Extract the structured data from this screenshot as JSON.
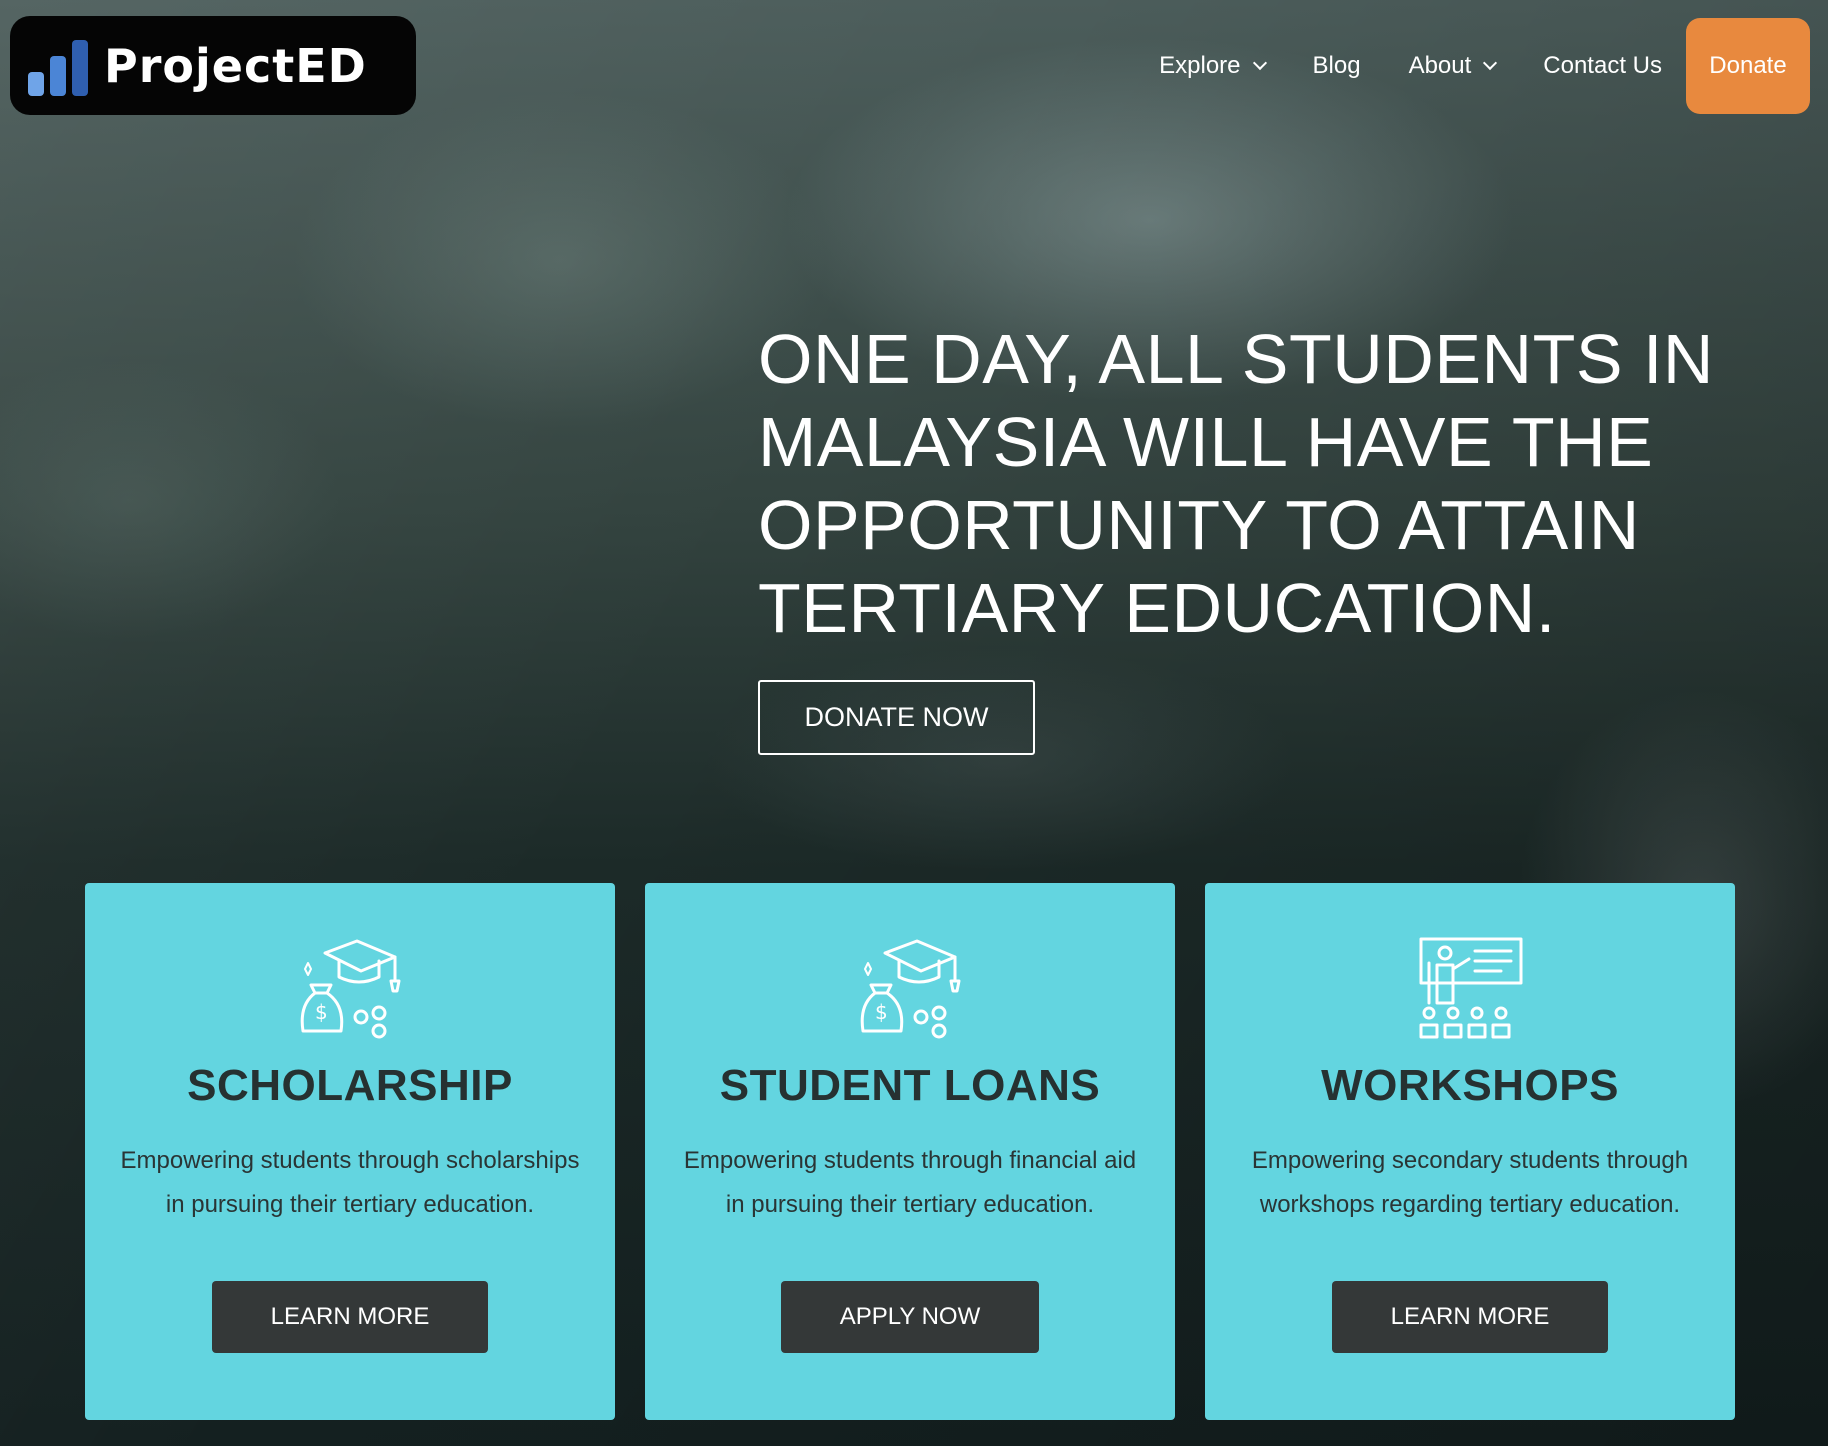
{
  "brand": {
    "name": "ProjectED"
  },
  "nav": {
    "items": [
      {
        "label": "Explore",
        "has_dropdown": true
      },
      {
        "label": "Blog",
        "has_dropdown": false
      },
      {
        "label": "About",
        "has_dropdown": true
      },
      {
        "label": "Contact Us",
        "has_dropdown": false
      }
    ],
    "donate_label": "Donate"
  },
  "hero": {
    "headline": "ONE DAY, ALL STUDENTS IN MALAYSIA WILL HAVE THE OPPORTUNITY TO ATTAIN TERTIARY EDUCATION.",
    "cta_label": "DONATE NOW"
  },
  "cards": [
    {
      "icon": "scholarship-icon",
      "title": "SCHOLARSHIP",
      "description": "Empowering students through scholarships in pursuing their tertiary education.",
      "button_label": "LEARN MORE"
    },
    {
      "icon": "student-loan-icon",
      "title": "STUDENT LOANS",
      "description": "Empowering students through financial aid in pursuing their tertiary education.",
      "button_label": "APPLY NOW"
    },
    {
      "icon": "workshop-icon",
      "title": "WORKSHOPS",
      "description": "Empowering secondary students through workshops regarding tertiary education.",
      "button_label": "LEARN MORE"
    }
  ],
  "colors": {
    "accent_orange": "#e8893e",
    "card_cyan": "#63d5e0",
    "button_dark": "#343838"
  }
}
